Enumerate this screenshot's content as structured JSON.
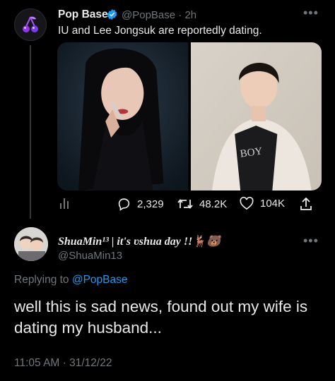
{
  "parent_tweet": {
    "author_name": "Pop Base",
    "handle": "@PopBase",
    "separator": "·",
    "time": "2h",
    "text": "IU and Lee Jongsuk are reportedly dating.",
    "stats": {
      "replies": "2,329",
      "retweets": "48.2K",
      "likes": "104K"
    },
    "icons": [
      "cherries-icon",
      "verified-badge-icon",
      "more-icon",
      "analytics-icon",
      "reply-icon",
      "retweet-icon",
      "like-icon",
      "share-icon"
    ]
  },
  "reply_tweet": {
    "display_name": "ShuaMin¹³ | it's ʋshua day !!🦌🐻",
    "handle": "@ShuaMin13",
    "replying_prefix": "Replying to",
    "replying_handle": "@PopBase",
    "text": "well this is sad news, found out my wife is dating my husband...",
    "timestamp": "11:05 AM · 31/12/22"
  },
  "colors": {
    "background": "#000000",
    "text": "#e7e9ea",
    "secondary": "#71767b",
    "accent": "#1d9bf0",
    "avatar_purple": "#7b2ff7"
  }
}
